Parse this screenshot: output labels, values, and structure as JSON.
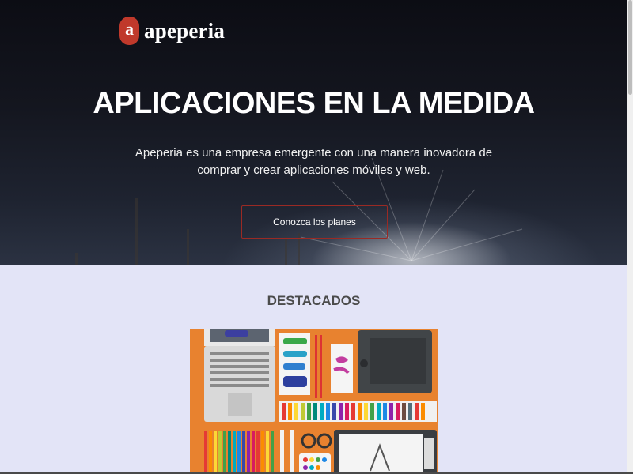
{
  "brand": {
    "logo_letter": "a",
    "name": "apeperia",
    "accent_color": "#c0392b"
  },
  "nav": {
    "items": [
      "",
      "",
      "",
      ""
    ]
  },
  "hero": {
    "title": "APLICACIONES EN LA MEDIDA",
    "subtitle": "Apeperia es una empresa emergente con una manera inovadora de comprar y crear aplicaciones móviles y web.",
    "cta_label": "Conozca los planes"
  },
  "featured": {
    "title": "DESTACADOS",
    "image_icon": "designer-desk-illustration"
  }
}
